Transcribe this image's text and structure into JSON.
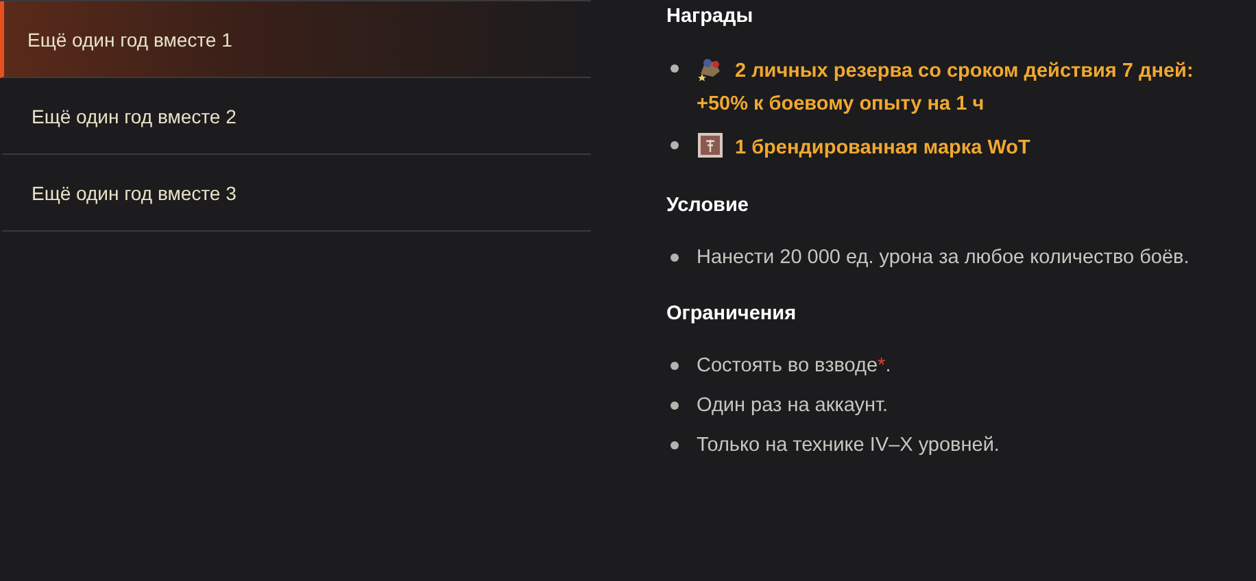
{
  "sidebar": {
    "items": [
      {
        "label": "Ещё один год вместе 1",
        "selected": true
      },
      {
        "label": "Ещё один год вместе 2",
        "selected": false
      },
      {
        "label": "Ещё один год вместе 3",
        "selected": false
      }
    ]
  },
  "sections": [
    {
      "heading": "Награды",
      "items": [
        {
          "kind": "reserve",
          "text": "2 личных резерва со сроком действия 7 дней: +50% к боевому опыту на 1 ч"
        },
        {
          "kind": "stamp",
          "text": "1 брендированная марка WoT"
        }
      ]
    },
    {
      "heading": "Условие",
      "items": [
        {
          "kind": "plain",
          "text": "Нанести 20 000 ед. урона за любое количество боёв."
        }
      ]
    },
    {
      "heading": "Ограничения",
      "items": [
        {
          "kind": "plain",
          "text": "Состоять во взводе",
          "footnote": "*",
          "tail": "."
        },
        {
          "kind": "plain",
          "text": "Один раз на аккаунт."
        },
        {
          "kind": "plain",
          "text": "Только на технике IV–X уровней."
        }
      ]
    }
  ]
}
